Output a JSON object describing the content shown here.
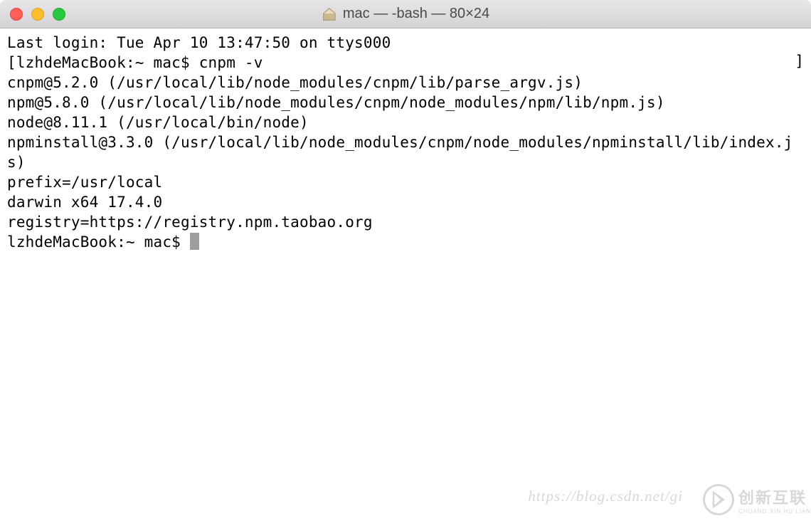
{
  "titlebar": {
    "title": "mac — -bash — 80×24"
  },
  "terminal": {
    "lines": [
      "Last login: Tue Apr 10 13:47:50 on ttys000",
      "[lzhdeMacBook:~ mac$ cnpm -v",
      "cnpm@5.2.0 (/usr/local/lib/node_modules/cnpm/lib/parse_argv.js)",
      "npm@5.8.0 (/usr/local/lib/node_modules/cnpm/node_modules/npm/lib/npm.js)",
      "node@8.11.1 (/usr/local/bin/node)",
      "npminstall@3.3.0 (/usr/local/lib/node_modules/cnpm/node_modules/npminstall/lib/index.js)",
      "prefix=/usr/local",
      "darwin x64 17.4.0",
      "registry=https://registry.npm.taobao.org"
    ],
    "prompt": "lzhdeMacBook:~ mac$ ",
    "right_bracket": "]"
  },
  "watermark": {
    "url": "https://blog.csdn.net/gi",
    "logo_main": "创新互联",
    "logo_sub": "CHUANG XIN HU LIAN"
  }
}
